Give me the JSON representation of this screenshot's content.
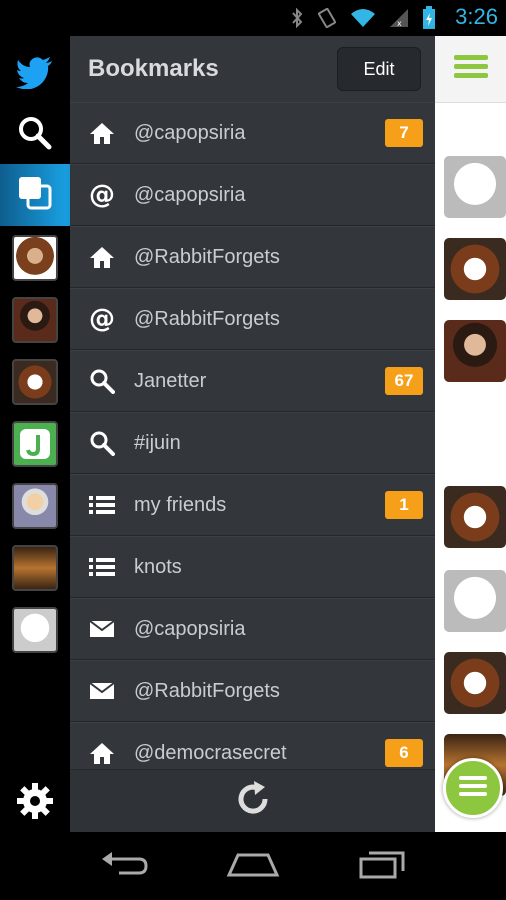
{
  "status": {
    "time": "3:26"
  },
  "drawer": {
    "title": "Bookmarks",
    "edit_label": "Edit",
    "items": [
      {
        "icon": "home-icon",
        "label": "@capopsiria",
        "badge": "7"
      },
      {
        "icon": "at-icon",
        "label": "@capopsiria",
        "badge": ""
      },
      {
        "icon": "home-icon",
        "label": "@RabbitForgets",
        "badge": ""
      },
      {
        "icon": "at-icon",
        "label": "@RabbitForgets",
        "badge": ""
      },
      {
        "icon": "search-icon",
        "label": "Janetter",
        "badge": "67"
      },
      {
        "icon": "search-icon",
        "label": "#ijuin",
        "badge": ""
      },
      {
        "icon": "list-icon",
        "label": "my friends",
        "badge": "1"
      },
      {
        "icon": "list-icon",
        "label": "knots",
        "badge": ""
      },
      {
        "icon": "mail-icon",
        "label": "@capopsiria",
        "badge": ""
      },
      {
        "icon": "mail-icon",
        "label": "@RabbitForgets",
        "badge": ""
      },
      {
        "icon": "home-icon",
        "label": "@democrasecret",
        "badge": "6"
      }
    ]
  },
  "colors": {
    "accent": "#33b5e5",
    "badge": "#f6a01a",
    "drawer_bg": "#33373c",
    "fab": "#8dc63f"
  }
}
